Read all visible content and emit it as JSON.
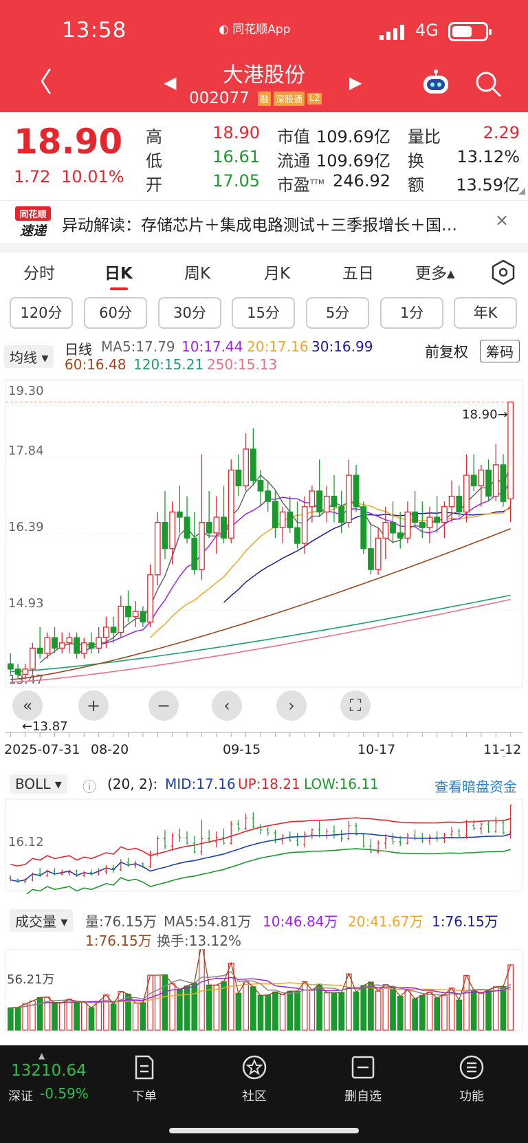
{
  "status": {
    "time": "13:58",
    "app_badge": "同花顺App",
    "network": "4G"
  },
  "nav": {
    "back_icon": "chevron-left-icon",
    "stock_name": "大港股份",
    "stock_code": "002077",
    "tags": [
      "融",
      "深股通",
      "L2"
    ],
    "prev_icon": "triangle-left-icon",
    "next_icon": "triangle-right-icon"
  },
  "quote": {
    "price": "18.90",
    "change": "1.72",
    "change_pct": "10.01%",
    "high_label": "高",
    "high": "18.90",
    "low_label": "低",
    "low": "16.61",
    "open_label": "开",
    "open": "17.05",
    "mktcap_label": "市值",
    "mktcap": "109.69亿",
    "float_label": "流通",
    "float": "109.69亿",
    "pe_label": "市盈",
    "pe_sup": "TTM",
    "pe": "246.92",
    "vr_label": "量比",
    "vr": "2.29",
    "turnover_label": "换",
    "turnover": "13.12%",
    "amount_label": "额",
    "amount": "13.59亿"
  },
  "anomaly": {
    "logo_top": "同花顺",
    "logo_bottom": "速递",
    "text": "异动解读：存储芯片＋集成电路测试＋三季报增长＋国…",
    "close": "×"
  },
  "period_tabs": [
    "分时",
    "日K",
    "周K",
    "月K",
    "五日",
    "更多▴"
  ],
  "minute_buttons": [
    "120分",
    "60分",
    "30分",
    "15分",
    "5分",
    "1分",
    "年K"
  ],
  "ma": {
    "indicator": "均线 ▾",
    "line_name": "日线",
    "ma5": "MA5:17.79",
    "ma10": "10:17.44",
    "ma20": "20:17.16",
    "ma30": "30:16.99",
    "ma60": "60:16.48",
    "ma120": "120:15.21",
    "ma250": "250:15.13",
    "fuquan": "前复权",
    "chouma": "筹码"
  },
  "kline_axis": {
    "y_labels": [
      "19.30",
      "17.84",
      "16.39",
      "14.93",
      "13.47"
    ],
    "x_labels": [
      "2025-07-31",
      "08-20",
      "09-15",
      "10-17",
      "11-12"
    ],
    "max_marker": "18.90→",
    "min_marker": "←13.87"
  },
  "boll": {
    "indicator": "BOLL ▾",
    "params": "(20, 2):",
    "mid": "MID:17.16",
    "up": "UP:18.21",
    "low": "LOW:16.11",
    "y_label": "16.12",
    "link": "查看暗盘资金"
  },
  "volume": {
    "indicator": "成交量 ▾",
    "vol": "量:76.15万",
    "ma5": "MA5:54.81万",
    "ma10": "10:46.84万",
    "ma20": "20:41.67万",
    "ma1a": "1:76.15万",
    "ma1b": "1:76.15万",
    "turnover": "换手:13.12%",
    "y_label": "56.21万"
  },
  "colors": {
    "up": "#e6262d",
    "down": "#1a9a2d",
    "ma5": "#666666",
    "ma10": "#a020f0",
    "ma20": "#f5a623",
    "ma30": "#1a1a9c",
    "ma60": "#a0461e",
    "ma120": "#1aa06e",
    "ma250": "#f07080"
  },
  "chart_data": {
    "type": "candlestick",
    "ylim": [
      13.47,
      19.3
    ],
    "candles": [
      [
        13.9,
        14.1,
        13.7,
        13.8
      ],
      [
        13.8,
        13.9,
        13.6,
        13.7
      ],
      [
        13.7,
        13.9,
        13.6,
        13.8
      ],
      [
        13.8,
        14.3,
        13.7,
        14.2
      ],
      [
        14.2,
        14.6,
        14.0,
        14.1
      ],
      [
        14.1,
        14.5,
        14.0,
        14.4
      ],
      [
        14.4,
        14.6,
        14.1,
        14.2
      ],
      [
        14.2,
        14.5,
        14.1,
        14.3
      ],
      [
        14.3,
        14.5,
        14.1,
        14.4
      ],
      [
        14.4,
        14.5,
        14.0,
        14.1
      ],
      [
        14.1,
        14.4,
        14.0,
        14.3
      ],
      [
        14.3,
        14.5,
        14.1,
        14.2
      ],
      [
        14.2,
        14.6,
        14.1,
        14.4
      ],
      [
        14.4,
        14.8,
        14.2,
        14.6
      ],
      [
        14.6,
        14.8,
        14.3,
        14.5
      ],
      [
        14.5,
        15.2,
        14.4,
        15.0
      ],
      [
        15.0,
        15.3,
        14.7,
        14.8
      ],
      [
        14.8,
        15.1,
        14.6,
        14.9
      ],
      [
        14.9,
        15.0,
        14.6,
        14.7
      ],
      [
        14.7,
        15.8,
        14.6,
        15.6
      ],
      [
        15.6,
        16.8,
        15.4,
        16.6
      ],
      [
        16.6,
        17.2,
        15.9,
        16.1
      ],
      [
        16.1,
        17.0,
        15.8,
        16.8
      ],
      [
        16.8,
        17.3,
        16.4,
        16.7
      ],
      [
        16.7,
        17.1,
        16.2,
        16.3
      ],
      [
        16.3,
        16.8,
        15.6,
        15.7
      ],
      [
        15.7,
        17.9,
        15.5,
        16.6
      ],
      [
        16.6,
        17.2,
        16.3,
        16.4
      ],
      [
        16.4,
        17.1,
        16.0,
        16.7
      ],
      [
        16.7,
        17.3,
        16.2,
        16.3
      ],
      [
        16.3,
        17.8,
        16.2,
        17.6
      ],
      [
        17.6,
        17.9,
        17.1,
        17.3
      ],
      [
        17.3,
        18.3,
        17.2,
        18.0
      ],
      [
        18.0,
        18.4,
        17.3,
        17.4
      ],
      [
        17.4,
        17.6,
        16.9,
        17.2
      ],
      [
        17.2,
        17.4,
        16.8,
        17.0
      ],
      [
        17.0,
        17.2,
        16.3,
        16.5
      ],
      [
        16.5,
        16.9,
        16.2,
        16.8
      ],
      [
        16.8,
        17.1,
        16.4,
        16.5
      ],
      [
        16.5,
        17.0,
        16.1,
        16.2
      ],
      [
        16.2,
        17.1,
        16.0,
        16.9
      ],
      [
        16.9,
        17.3,
        16.6,
        17.2
      ],
      [
        17.2,
        17.8,
        16.7,
        16.8
      ],
      [
        16.8,
        17.3,
        16.6,
        17.1
      ],
      [
        17.1,
        17.5,
        16.6,
        16.9
      ],
      [
        16.9,
        17.2,
        16.4,
        16.6
      ],
      [
        16.6,
        17.8,
        16.5,
        17.5
      ],
      [
        17.5,
        17.7,
        16.8,
        16.9
      ],
      [
        16.9,
        17.0,
        16.0,
        16.1
      ],
      [
        16.1,
        16.6,
        15.6,
        15.7
      ],
      [
        15.7,
        16.5,
        15.6,
        16.3
      ],
      [
        16.3,
        16.9,
        15.9,
        16.6
      ],
      [
        16.6,
        17.0,
        16.2,
        16.4
      ],
      [
        16.4,
        16.8,
        16.1,
        16.3
      ],
      [
        16.3,
        17.0,
        16.2,
        16.8
      ],
      [
        16.8,
        17.2,
        16.5,
        16.6
      ],
      [
        16.6,
        17.0,
        16.3,
        16.5
      ],
      [
        16.5,
        16.9,
        16.2,
        16.7
      ],
      [
        16.7,
        17.1,
        16.4,
        16.6
      ],
      [
        16.6,
        17.0,
        16.3,
        16.9
      ],
      [
        16.9,
        17.4,
        16.6,
        17.1
      ],
      [
        17.1,
        17.3,
        16.7,
        16.8
      ],
      [
        16.8,
        17.9,
        16.6,
        17.5
      ],
      [
        17.5,
        17.9,
        17.2,
        17.3
      ],
      [
        17.3,
        17.7,
        16.9,
        17.6
      ],
      [
        17.6,
        17.8,
        17.0,
        17.1
      ],
      [
        17.1,
        18.1,
        17.0,
        17.7
      ],
      [
        17.7,
        17.9,
        16.9,
        17.0
      ],
      [
        17.05,
        18.9,
        16.61,
        18.9
      ]
    ]
  }
}
